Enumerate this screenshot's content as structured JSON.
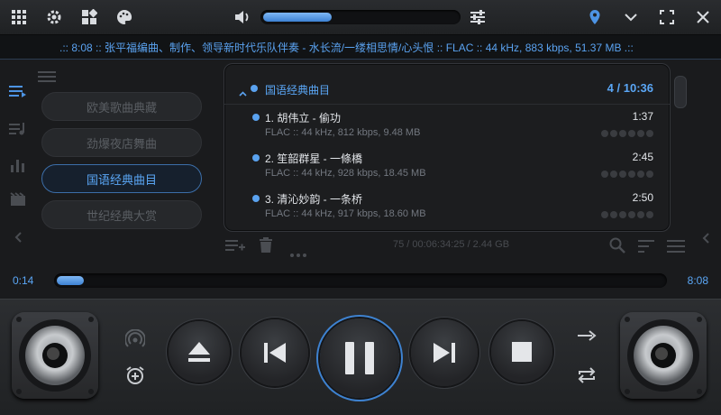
{
  "topbar": {
    "icons": [
      "grid-icon",
      "gear-icon",
      "layout-icon",
      "palette-icon",
      "volume-icon",
      "equalizer-icon",
      "location-icon",
      "chevron-down-icon",
      "fullscreen-icon",
      "close-icon"
    ],
    "volume_level": 0.35
  },
  "ticker": {
    "text": ".:: 8:08 :: 张平福编曲、制作、领导新时代乐队伴奏 - 水长流/一缕相思情/心头恨 :: FLAC :: 44 kHz, 883 kbps, 51.37 MB .::"
  },
  "categories": [
    {
      "label": "欧美歌曲典藏",
      "active": false
    },
    {
      "label": "劲爆夜店舞曲",
      "active": false
    },
    {
      "label": "国语经典曲目",
      "active": true
    },
    {
      "label": "世纪经典大赏",
      "active": false
    }
  ],
  "playlist": {
    "title": "国语经典曲目",
    "summary": "4 / 10:36",
    "tracks": [
      {
        "title": "1. 胡伟立 - 偷功",
        "meta": "FLAC :: 44 kHz, 812 kbps, 9.48 MB",
        "duration": "1:37"
      },
      {
        "title": "2. 笙韶群星 - 一條橋",
        "meta": "FLAC :: 44 kHz, 928 kbps, 18.45 MB",
        "duration": "2:45"
      },
      {
        "title": "3. 清沁妙韵 - 一条桥",
        "meta": "FLAC :: 44 kHz, 917 kbps, 18.60 MB",
        "duration": "2:50"
      }
    ],
    "footer_stats": "75 / 00:06:34:25 / 2.44 GB"
  },
  "progress": {
    "elapsed": "0:14",
    "total": "8:08",
    "fraction": 0.03
  },
  "colors": {
    "accent": "#5aa2f0",
    "background": "#1a1b1d"
  }
}
